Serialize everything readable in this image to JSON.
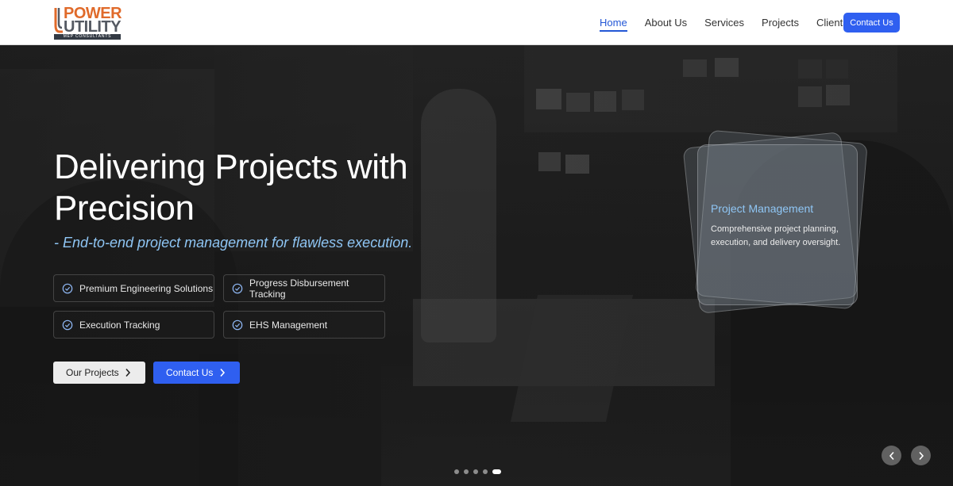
{
  "header": {
    "logo": {
      "line1": "POWER",
      "line2": "UTILITY",
      "sub": "MEP CONSULTANTS",
      "icon": "power-utility-logo"
    },
    "nav": [
      {
        "label": "Home",
        "active": true
      },
      {
        "label": "About Us",
        "active": false
      },
      {
        "label": "Services",
        "active": false
      },
      {
        "label": "Projects",
        "active": false
      },
      {
        "label": "Clients",
        "active": false
      }
    ],
    "cta_label": "Contact Us"
  },
  "hero": {
    "title": "Delivering Projects with Precision",
    "subtitle": "- End-to-end project management for flawless execution.",
    "features": [
      {
        "label": "Premium Engineering Solutions",
        "icon": "check-circle-icon"
      },
      {
        "label": "Progress Disbursement Tracking",
        "icon": "check-circle-icon"
      },
      {
        "label": "Execution Tracking",
        "icon": "check-circle-icon"
      },
      {
        "label": "EHS Management",
        "icon": "check-circle-icon"
      }
    ],
    "buttons": {
      "projects_label": "Our Projects",
      "contact_label": "Contact Us"
    },
    "card": {
      "title": "Project Management",
      "text": "Comprehensive project planning, execution, and delivery oversight."
    },
    "slider": {
      "total_slides": 5,
      "active_slide": 5
    }
  },
  "colors": {
    "accent": "#2f5ff0",
    "highlight": "#8fc6f5",
    "logo_orange": "#e06a2a",
    "logo_gray": "#555a63"
  }
}
